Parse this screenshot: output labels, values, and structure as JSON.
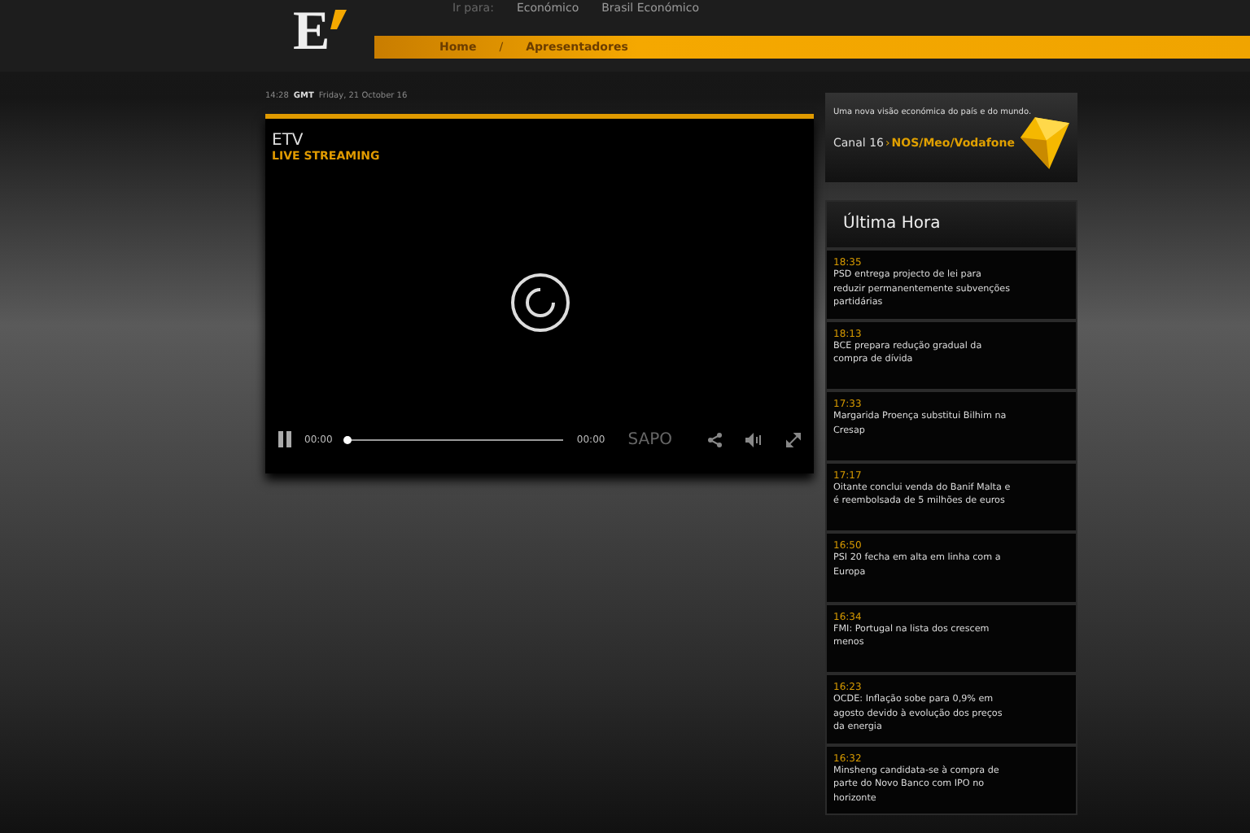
{
  "top_links": [
    "Ir para:",
    "Económico",
    "Brasil Económico"
  ],
  "logo": {
    "letter": "E"
  },
  "nav": [
    {
      "label": "Home",
      "selected": false
    },
    {
      "label": "Apresentadores",
      "selected": false
    }
  ],
  "nav_separator": "/",
  "clock": {
    "time": "14:28",
    "zone": "GMT",
    "date": "Friday, 21 October 16"
  },
  "player": {
    "title": "ETV",
    "subtitle": "LIVE STREAMING",
    "playing": true,
    "current_time": "00:00",
    "duration": "00:00",
    "level": 0,
    "brand": "SAPO"
  },
  "ad": {
    "tagline": "Uma nova visão económica do país e do mundo.",
    "channel": "Canal 16",
    "chevron": "›",
    "operators": "NOS/Meo/Vodafone"
  },
  "news": {
    "title": "Última Hora",
    "items": [
      {
        "time": "18:35",
        "headline": "PSD entrega projecto de lei para reduzir permanentemente subvenções partidárias"
      },
      {
        "time": "18:13",
        "headline": "BCE prepara redução gradual da compra de dívida"
      },
      {
        "time": "17:33",
        "headline": "Margarida Proença substitui Bilhim na Cresap"
      },
      {
        "time": "17:17",
        "headline": "Oitante conclui venda do Banif Malta e é reembolsada de 5 milhões de euros"
      },
      {
        "time": "16:50",
        "headline": "PSI 20 fecha em alta em linha com a Europa"
      },
      {
        "time": "16:34",
        "headline": "FMI: Portugal na lista dos crescem menos"
      },
      {
        "time": "16:23",
        "headline": "OCDE: Inflação sobe para 0,9% em agosto devido à evolução dos preços da energia"
      },
      {
        "time": "16:32",
        "headline": "Minsheng candidata-se à compra de parte do Novo Banco com IPO no horizonte"
      }
    ]
  }
}
